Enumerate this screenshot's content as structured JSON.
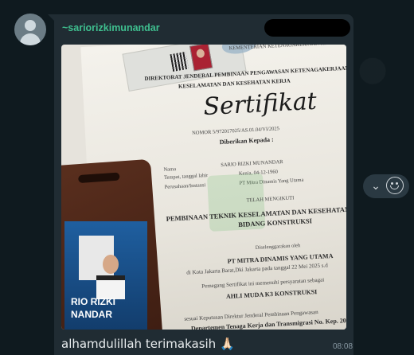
{
  "message": {
    "sender": "~sariorizkimunandar",
    "caption": "alhamdulillah terimakasih 🙏🏻",
    "time": "08:08"
  },
  "certificate": {
    "header1": "KEMENTERIAN KETENAGAKERJAAN REPUBLIK INDONESIA",
    "header2": "DIREKTORAT JENDERAL PEMBINAAN PENGAWASAN KETENAGAKERJAAN DAN",
    "header3": "KESELAMATAN DAN KESEHATAN KERJA",
    "title": "Sertifikat",
    "number": "NOMOR 5/972017025/AS.01.04/VI/2025",
    "given_to": "Diberikan Kepada :",
    "name_label": "Nama",
    "name": "SARIO RIZKI MUNANDAR",
    "birth_label": "Tempat, tanggal lahir",
    "birth": "Kenia, 04-12-1960",
    "company_label": "Perusahaan/Instansi",
    "company": "PT Mitra Dinamis Yang Utama",
    "attended": "TELAH MENGIKUTI",
    "course1": "PEMBINAAN TEKNIK KESELAMATAN DAN KESEHATAN KERJA",
    "course2": "BIDANG KONSTRUKSI",
    "organized": "Diselenggarakan oleh",
    "organizer": "PT MITRA DINAMIS YANG UTAMA",
    "location": "di Kota Jakarta Barat,Dki Jakarta pada tanggal 22 Mei 2025 s.d",
    "holder": "Pemegang Sertifikat ini memenuhi persyaratan sebagai",
    "role": "AHLI MUDA K3 KONSTRUKSI",
    "decree1": "sesuai Keputusan Direktur Jenderal Pembinaan Pengawasan",
    "decree2": "Departemen Tenaga Kerja dan Transmigrasi No. Kep. 20"
  },
  "id_badge": {
    "name_line1": "RIO RIZKI",
    "name_line2": "NANDAR"
  }
}
